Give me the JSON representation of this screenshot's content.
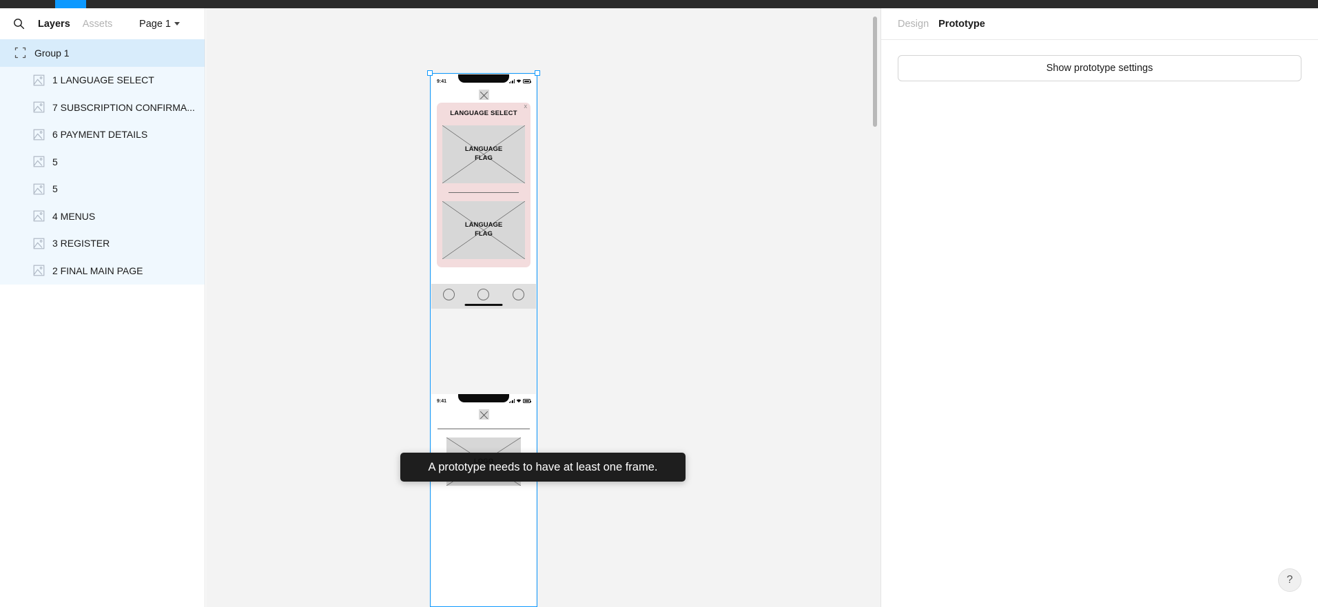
{
  "app": {
    "topbar_accent_color": "#0d99ff"
  },
  "sidebar": {
    "search_icon": "search-icon",
    "tabs": [
      {
        "label": "Layers",
        "active": true
      },
      {
        "label": "Assets",
        "active": false
      }
    ],
    "page_select": {
      "label": "Page 1",
      "caret": "chevron-down-icon"
    },
    "layers": [
      {
        "label": "Group 1",
        "type": "group",
        "selected": true
      },
      {
        "label": "1 LANGUAGE SELECT",
        "type": "image"
      },
      {
        "label": "7 SUBSCRIPTION CONFIRMA...",
        "type": "image"
      },
      {
        "label": "6 PAYMENT DETAILS",
        "type": "image"
      },
      {
        "label": "5",
        "type": "image"
      },
      {
        "label": "5",
        "type": "image"
      },
      {
        "label": "4 MENUS",
        "type": "image"
      },
      {
        "label": "3 REGISTER",
        "type": "image"
      },
      {
        "label": "2 FINAL MAIN PAGE",
        "type": "image"
      }
    ]
  },
  "canvas": {
    "background_color": "#f3f3f3",
    "selection_color": "#0d99ff",
    "artboard_1": {
      "status_time": "9:41",
      "close_icon": "close-x-icon",
      "card": {
        "title": "LANGUAGE SELECT",
        "close_label": "X",
        "background_color": "#f3dcdd",
        "options": [
          {
            "label_line1": "LANGUAGE",
            "label_line2": "FLAG"
          },
          {
            "label_line1": "LANGUAGE",
            "label_line2": "FLAG"
          }
        ]
      },
      "tabbar_items": [
        "tab-circle-1",
        "tab-circle-2",
        "tab-circle-3"
      ]
    },
    "artboard_2": {
      "status_time": "9:41",
      "close_icon": "close-x-icon",
      "logo_label": "LOGO"
    }
  },
  "right_panel": {
    "tabs": [
      {
        "label": "Design",
        "active": false
      },
      {
        "label": "Prototype",
        "active": true
      }
    ],
    "prototype_settings_button": "Show prototype settings"
  },
  "toast": {
    "message": "A prototype needs to have at least one frame."
  },
  "help": {
    "label": "?"
  }
}
